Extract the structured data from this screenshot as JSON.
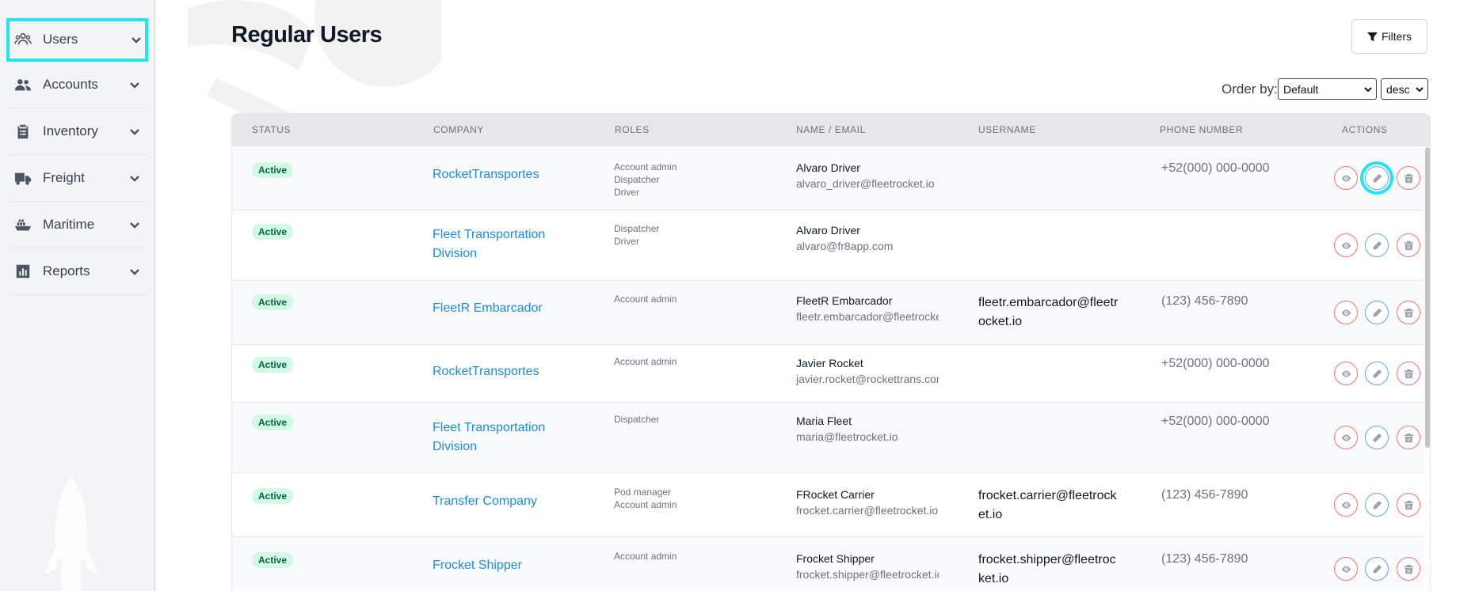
{
  "sidebar": {
    "items": [
      {
        "label": "Users",
        "icon": "users-icon"
      },
      {
        "label": "Accounts",
        "icon": "accounts-icon"
      },
      {
        "label": "Inventory",
        "icon": "clipboard-icon"
      },
      {
        "label": "Freight",
        "icon": "truck-icon"
      },
      {
        "label": "Maritime",
        "icon": "ship-icon"
      },
      {
        "label": "Reports",
        "icon": "chart-icon"
      }
    ]
  },
  "header": {
    "title": "Regular Users",
    "filters_label": "Filters",
    "order_by_label": "Order by:",
    "order_by_value": "Default",
    "order_dir_value": "desc"
  },
  "table": {
    "columns": [
      "STATUS",
      "COMPANY",
      "ROLES",
      "NAME / EMAIL",
      "USERNAME",
      "PHONE NUMBER",
      "ACTIONS"
    ],
    "rows": [
      {
        "status": "Active",
        "company": "RocketTransportes",
        "roles": [
          "Account admin",
          "Dispatcher",
          "Driver"
        ],
        "name": "Alvaro Driver",
        "email": "alvaro_driver@fleetrocket.io",
        "username": "",
        "phone": "+52(000) 000-0000"
      },
      {
        "status": "Active",
        "company": "Fleet Transportation Division",
        "roles": [
          "Dispatcher",
          "Driver"
        ],
        "name": "Alvaro Driver",
        "email": "alvaro@fr8app.com",
        "username": "",
        "phone": ""
      },
      {
        "status": "Active",
        "company": "FleetR Embarcador",
        "roles": [
          "Account admin"
        ],
        "name": "FleetR Embarcador",
        "email": "fleetr.embarcador@fleetrocke",
        "username": "fleetr.embarcador@fleetrocket.io",
        "phone": "(123) 456-7890"
      },
      {
        "status": "Active",
        "company": "RocketTransportes",
        "roles": [
          "Account admin"
        ],
        "name": "Javier Rocket",
        "email": "javier.rocket@rockettrans.cor",
        "username": "",
        "phone": "+52(000) 000-0000"
      },
      {
        "status": "Active",
        "company": "Fleet Transportation Division",
        "roles": [
          "Dispatcher"
        ],
        "name": "Maria Fleet",
        "email": "maria@fleetrocket.io",
        "username": "",
        "phone": "+52(000) 000-0000"
      },
      {
        "status": "Active",
        "company": "Transfer Company",
        "roles": [
          "Pod manager",
          "Account admin"
        ],
        "name": "FRocket Carrier",
        "email": "frocket.carrier@fleetrocket.io",
        "username": "frocket.carrier@fleetrocket.io",
        "phone": "(123) 456-7890"
      },
      {
        "status": "Active",
        "company": "Frocket Shipper",
        "roles": [
          "Account admin"
        ],
        "name": "Frocket Shipper",
        "email": "frocket.shipper@fleetrocket.io",
        "username": "frocket.shipper@fleetrocket.io",
        "phone": "(123) 456-7890"
      }
    ]
  }
}
